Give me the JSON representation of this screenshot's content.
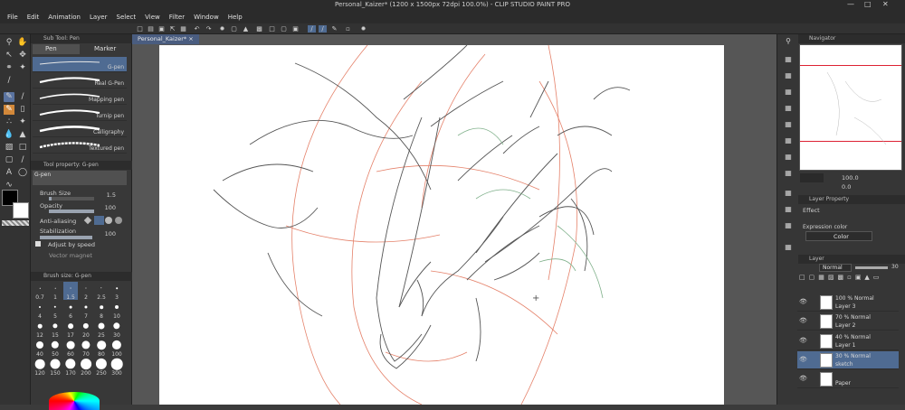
{
  "app": {
    "title": "Personal_Kaizer* (1200 x 1500px 72dpi 100.0%) - CLIP STUDIO PAINT PRO"
  },
  "menu": [
    "File",
    "Edit",
    "Animation",
    "Layer",
    "Select",
    "View",
    "Filter",
    "Window",
    "Help"
  ],
  "window_controls": [
    "minimize-icon",
    "maximize-icon",
    "close-icon"
  ],
  "document_tab": "Personal_Kaizer*",
  "subtool_panel": {
    "header": "Sub Tool: Pen",
    "tabs": [
      "Pen",
      "Marker"
    ],
    "brushes": [
      "G-pen",
      "Real G-Pen",
      "Mapping pen",
      "Turnip pen",
      "Calligraphy",
      "Textured pen"
    ],
    "selected_brush": "G-pen"
  },
  "tool_property": {
    "header": "Tool property: G-pen",
    "name": "G-pen",
    "brush_size_label": "Brush Size",
    "brush_size_value": "1.5",
    "opacity_label": "Opacity",
    "opacity_value": "100",
    "anti_aliasing_label": "Anti-aliasing",
    "stabilization_label": "Stabilization",
    "stabilization_value": "100",
    "adjust_by_speed_label": "Adjust by speed",
    "vector_magnet_label": "Vector magnet"
  },
  "brush_size_panel": {
    "header": "Brush size: G-pen",
    "sizes": [
      "0.7",
      "1",
      "1.5",
      "2",
      "2.5",
      "3",
      "4",
      "5",
      "6",
      "7",
      "8",
      "10",
      "12",
      "15",
      "17",
      "20",
      "25",
      "30",
      "40",
      "50",
      "60",
      "70",
      "80",
      "100",
      "120",
      "150",
      "170",
      "200",
      "250",
      "300"
    ],
    "selected": "1.5"
  },
  "navigator": {
    "header": "Navigator",
    "zoom": "100.0",
    "rotation": "0.0"
  },
  "layer_property": {
    "header": "Layer Property",
    "effect_label": "Effect",
    "expression_color_label": "Expression color",
    "expression_color_value": "Color"
  },
  "layer_panel": {
    "header": "Layer",
    "blend_mode": "Normal",
    "opacity": "30",
    "layers": [
      {
        "blend": "100 % Normal",
        "name": "Layer 3",
        "selected": false
      },
      {
        "blend": "70 % Normal",
        "name": "Layer 2",
        "selected": false
      },
      {
        "blend": "40 % Normal",
        "name": "Layer 1",
        "selected": false
      },
      {
        "blend": "30 % Normal",
        "name": "sketch",
        "selected": true
      },
      {
        "blend": "",
        "name": "Paper",
        "selected": false
      }
    ]
  },
  "colors": {
    "accent": "#4f6b92",
    "sketch_red": "#e2745a",
    "ink": "#444444",
    "green_line": "#7fb08a",
    "main_color": "#000000",
    "sub_color": "#ffffff"
  }
}
